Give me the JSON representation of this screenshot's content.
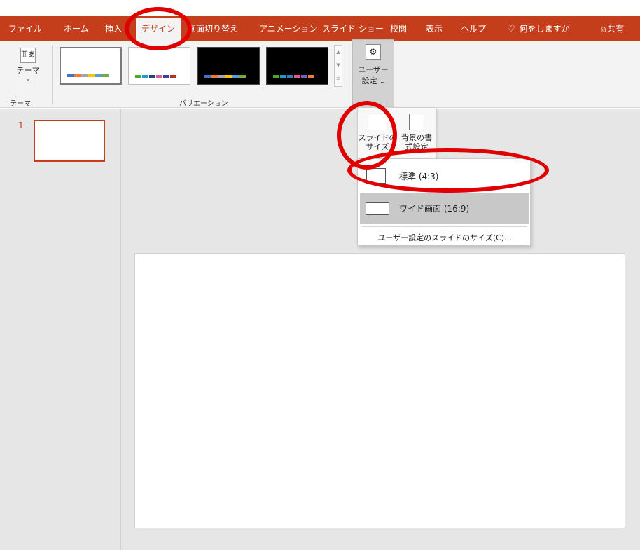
{
  "ribbon_tabs": [
    "ファイル",
    "ホーム",
    "挿入",
    "デザイン",
    "画面切り替え",
    "アニメーション",
    "スライド ショー",
    "校閲",
    "表示",
    "ヘルプ"
  ],
  "tell_me": "何をしますか",
  "share": "共有",
  "themes_group": {
    "button_label": "テーマ",
    "label": "テーマ",
    "icon_text": "亜あ"
  },
  "variations_group": {
    "label": "バリエーション"
  },
  "customize_button": {
    "label1": "ユーザー",
    "label2": "設定"
  },
  "slide_size_button": {
    "label1": "スライドの",
    "label2": "サイズ"
  },
  "format_bg_button": {
    "label1": "背景の書",
    "label2": "式設定"
  },
  "slide_size_menu": {
    "standard": "標準 (4:3)",
    "widescreen": "ワイド画面 (16:9)",
    "custom": "ユーザー設定のスライドのサイズ(C)..."
  },
  "slides": [
    {
      "number": "1"
    }
  ],
  "colors": {
    "accent": "#c43e1c",
    "highlight_ring": "#e00000"
  }
}
